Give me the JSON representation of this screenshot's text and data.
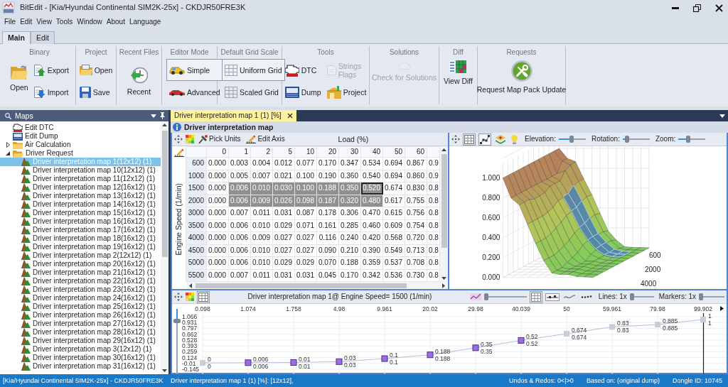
{
  "window": {
    "title": "BitEdit - [Kia/Hyundai Continental SIM2K-25x] - CKDJR50FRE3K"
  },
  "menu": [
    "File",
    "Edit",
    "View",
    "Tools",
    "Window",
    "About",
    "Language"
  ],
  "ribbon_tabs": [
    {
      "label": "Main",
      "selected": true
    },
    {
      "label": "Edit",
      "selected": false
    }
  ],
  "ribbon_groups": [
    {
      "title": "Binary",
      "buttons": [
        {
          "label": "Open",
          "kind": "large"
        },
        {
          "label": "Export",
          "kind": "small"
        },
        {
          "label": "Import",
          "kind": "small"
        }
      ]
    },
    {
      "title": "Project",
      "buttons": [
        {
          "label": "Open",
          "kind": "small"
        },
        {
          "label": "Save",
          "kind": "small"
        }
      ]
    },
    {
      "title": "Recent Files",
      "buttons": [
        {
          "label": "Recent",
          "kind": "large"
        }
      ]
    },
    {
      "title": "Editor Mode",
      "buttons": [
        {
          "label": "Simple",
          "kind": "small",
          "selected": true
        },
        {
          "label": "Advanced",
          "kind": "small",
          "selected": false
        }
      ]
    },
    {
      "title": "Default Grid Scale",
      "buttons": [
        {
          "label": "Uniform Grid",
          "kind": "small",
          "selected": true
        },
        {
          "label": "Scaled Grid",
          "kind": "small",
          "selected": false
        }
      ]
    },
    {
      "title": "Tools",
      "buttons": [
        {
          "label": "DTC",
          "kind": "small",
          "disabled": false
        },
        {
          "label": "Dump",
          "kind": "small",
          "disabled": false
        },
        {
          "label": "Strings Flags",
          "kind": "small",
          "disabled": true
        },
        {
          "label": "Project",
          "kind": "small",
          "disabled": false
        }
      ]
    },
    {
      "title": "Solutions",
      "buttons": [
        {
          "label": "Check for Solutions",
          "kind": "large",
          "disabled": true
        }
      ]
    },
    {
      "title": "Diff",
      "buttons": [
        {
          "label": "View Diff",
          "kind": "large"
        }
      ]
    },
    {
      "title": "Requests",
      "buttons": [
        {
          "label": "Request Map Pack Update",
          "kind": "large"
        }
      ]
    }
  ],
  "maps_panel": {
    "title": "Maps",
    "items": [
      {
        "label": "Edit DTC",
        "kind": "dtc",
        "selected": false
      },
      {
        "label": "Edit Dump",
        "kind": "dump",
        "selected": false
      },
      {
        "label": "Air Calculation",
        "kind": "folder",
        "expanded": false,
        "selected": false
      },
      {
        "label": "Driver Request",
        "kind": "folder",
        "expanded": true,
        "selected": false,
        "children": [
          {
            "label": "Driver interpretation map 1(12x12) (1)",
            "kind": "map",
            "selected": true
          },
          {
            "label": "Driver interpretation map 10(12x12) (1)",
            "kind": "map",
            "selected": false
          },
          {
            "label": "Driver interpretation map 11(12x12) (1)",
            "kind": "map",
            "selected": false
          },
          {
            "label": "Driver interpretation map 12(16x12) (1)",
            "kind": "map",
            "selected": false
          },
          {
            "label": "Driver interpretation map 13(16x12) (1)",
            "kind": "map",
            "selected": false
          },
          {
            "label": "Driver interpretation map 14(16x12) (1)",
            "kind": "map",
            "selected": false
          },
          {
            "label": "Driver interpretation map 15(16x12) (1)",
            "kind": "map",
            "selected": false
          },
          {
            "label": "Driver interpretation map 16(16x12) (1)",
            "kind": "map",
            "selected": false
          },
          {
            "label": "Driver interpretation map 17(16x12) (1)",
            "kind": "map",
            "selected": false
          },
          {
            "label": "Driver interpretation map 18(16x12) (1)",
            "kind": "map",
            "selected": false
          },
          {
            "label": "Driver interpretation map 19(16x12) (1)",
            "kind": "map",
            "selected": false
          },
          {
            "label": "Driver interpretation map 2(12x12) (1)",
            "kind": "map",
            "selected": false
          },
          {
            "label": "Driver interpretation map 20(16x12) (1)",
            "kind": "map",
            "selected": false
          },
          {
            "label": "Driver interpretation map 21(16x12) (1)",
            "kind": "map",
            "selected": false
          },
          {
            "label": "Driver interpretation map 22(16x12) (1)",
            "kind": "map",
            "selected": false
          },
          {
            "label": "Driver interpretation map 23(16x12) (1)",
            "kind": "map",
            "selected": false
          },
          {
            "label": "Driver interpretation map 24(16x12) (1)",
            "kind": "map",
            "selected": false
          },
          {
            "label": "Driver interpretation map 25(16x12) (1)",
            "kind": "map",
            "selected": false
          },
          {
            "label": "Driver interpretation map 26(16x12) (1)",
            "kind": "map",
            "selected": false
          },
          {
            "label": "Driver interpretation map 27(16x12) (1)",
            "kind": "map",
            "selected": false
          },
          {
            "label": "Driver interpretation map 28(16x12) (1)",
            "kind": "map",
            "selected": false
          },
          {
            "label": "Driver interpretation map 29(16x12) (1)",
            "kind": "map",
            "selected": false
          },
          {
            "label": "Driver interpretation map 3(12x12) (1)",
            "kind": "map",
            "selected": false
          },
          {
            "label": "Driver interpretation map 30(16x12) (1)",
            "kind": "map",
            "selected": false
          },
          {
            "label": "Driver interpretation map 31(16x12) (1)",
            "kind": "map",
            "selected": false
          }
        ]
      }
    ]
  },
  "doc_tabs": [
    {
      "label": "Driver interpretation map 1 (1) [%]",
      "selected": true
    }
  ],
  "map_panel": {
    "title": "Driver interpretation map",
    "toolbar_buttons": [
      "Pick Units",
      "Edit Axis"
    ],
    "x_axis_title": "Load (%)",
    "y_axis_title": "Engine Speed (1/min)",
    "columns": [
      "0",
      "1",
      "2",
      "5",
      "10",
      "20",
      "30",
      "40",
      "50",
      "60"
    ],
    "rows": [
      {
        "label": "600",
        "values": [
          "0.000",
          "0.003",
          "0.004",
          "0.012",
          "0.077",
          "0.170",
          "0.347",
          "0.534",
          "0.694",
          "0.867",
          "0.9"
        ],
        "selected": [
          false,
          false,
          false,
          false,
          false,
          false,
          false,
          false,
          false,
          false,
          false
        ],
        "focused": [
          false,
          false,
          false,
          false,
          false,
          false,
          false,
          false,
          false,
          false,
          false
        ]
      },
      {
        "label": "1000",
        "values": [
          "0.000",
          "0.005",
          "0.007",
          "0.021",
          "0.100",
          "0.190",
          "0.360",
          "0.540",
          "0.694",
          "0.860",
          "0.9"
        ],
        "selected": [
          false,
          false,
          false,
          false,
          false,
          false,
          false,
          false,
          false,
          false,
          false
        ],
        "focused": [
          false,
          false,
          false,
          false,
          false,
          false,
          false,
          false,
          false,
          false,
          false
        ]
      },
      {
        "label": "1500",
        "values": [
          "0.000",
          "0.006",
          "0.010",
          "0.030",
          "0.100",
          "0.188",
          "0.350",
          "0.520",
          "0.674",
          "0.830",
          "0.8"
        ],
        "selected": [
          false,
          true,
          true,
          true,
          true,
          true,
          true,
          true,
          false,
          false,
          false
        ],
        "focused": [
          false,
          false,
          false,
          false,
          false,
          false,
          false,
          true,
          false,
          false,
          false
        ]
      },
      {
        "label": "2000",
        "values": [
          "0.000",
          "0.006",
          "0.009",
          "0.026",
          "0.098",
          "0.187",
          "0.320",
          "0.480",
          "0.617",
          "0.755",
          "0.8"
        ],
        "selected": [
          false,
          true,
          true,
          true,
          true,
          true,
          true,
          true,
          false,
          false,
          false
        ],
        "focused": [
          false,
          false,
          false,
          false,
          false,
          false,
          false,
          false,
          false,
          false,
          false
        ]
      },
      {
        "label": "3000",
        "values": [
          "0.000",
          "0.007",
          "0.011",
          "0.031",
          "0.087",
          "0.178",
          "0.306",
          "0.470",
          "0.615",
          "0.756",
          "0.8"
        ],
        "selected": [
          false,
          false,
          false,
          false,
          false,
          false,
          false,
          false,
          false,
          false,
          false
        ],
        "focused": [
          false,
          false,
          false,
          false,
          false,
          false,
          false,
          false,
          false,
          false,
          false
        ]
      },
      {
        "label": "3500",
        "values": [
          "0.000",
          "0.006",
          "0.010",
          "0.029",
          "0.071",
          "0.161",
          "0.285",
          "0.460",
          "0.609",
          "0.754",
          "0.8"
        ],
        "selected": [
          false,
          false,
          false,
          false,
          false,
          false,
          false,
          false,
          false,
          false,
          false
        ],
        "focused": [
          false,
          false,
          false,
          false,
          false,
          false,
          false,
          false,
          false,
          false,
          false
        ]
      },
      {
        "label": "4000",
        "values": [
          "0.000",
          "0.006",
          "0.009",
          "0.027",
          "0.027",
          "0.116",
          "0.240",
          "0.420",
          "0.568",
          "0.720",
          "0.8"
        ],
        "selected": [
          false,
          false,
          false,
          false,
          false,
          false,
          false,
          false,
          false,
          false,
          false
        ],
        "focused": [
          false,
          false,
          false,
          false,
          false,
          false,
          false,
          false,
          false,
          false,
          false
        ]
      },
      {
        "label": "4500",
        "values": [
          "0.000",
          "0.006",
          "0.010",
          "0.027",
          "0.027",
          "0.090",
          "0.210",
          "0.390",
          "0.549",
          "0.713",
          "0.8"
        ],
        "selected": [
          false,
          false,
          false,
          false,
          false,
          false,
          false,
          false,
          false,
          false,
          false
        ],
        "focused": [
          false,
          false,
          false,
          false,
          false,
          false,
          false,
          false,
          false,
          false,
          false
        ]
      },
      {
        "label": "5000",
        "values": [
          "0.000",
          "0.006",
          "0.010",
          "0.029",
          "0.029",
          "0.070",
          "0.188",
          "0.359",
          "0.537",
          "0.708",
          "0.8"
        ],
        "selected": [
          false,
          false,
          false,
          false,
          false,
          false,
          false,
          false,
          false,
          false,
          false
        ],
        "focused": [
          false,
          false,
          false,
          false,
          false,
          false,
          false,
          false,
          false,
          false,
          false
        ]
      },
      {
        "label": "5500",
        "values": [
          "0.000",
          "0.007",
          "0.011",
          "0.031",
          "0.031",
          "0.045",
          "0.170",
          "0.342",
          "0.536",
          "0.730",
          "0.8"
        ],
        "selected": [
          false,
          false,
          false,
          false,
          false,
          false,
          false,
          false,
          false,
          false,
          false
        ],
        "focused": [
          false,
          false,
          false,
          false,
          false,
          false,
          false,
          false,
          false,
          false,
          false
        ]
      }
    ]
  },
  "surface_panel": {
    "toggles": [
      {
        "pressed": true
      },
      {
        "pressed": true
      },
      {
        "pressed": false
      },
      {
        "pressed": false
      }
    ],
    "sliders": [
      {
        "label": "Elevation:",
        "level": 0.47
      },
      {
        "label": "Rotation:",
        "level": 0.15
      },
      {
        "label": "Zoom:",
        "level": 0.37
      }
    ],
    "z_labels": [
      "1.000",
      "0.800",
      "0.600",
      "0.400",
      "0.200",
      "0.000"
    ],
    "y_labels": [
      "600",
      "2000",
      "4000"
    ]
  },
  "profile_chart": {
    "title": "Driver interpretation map 1@ Engine Speed= 1500 (1/min)",
    "toggles": [
      {
        "pressed": true
      },
      {
        "pressed": true
      },
      {
        "pressed": true
      },
      {
        "pressed": false
      },
      {
        "pressed": false
      }
    ],
    "sliders": [
      {
        "level": 0.05
      },
      {
        "label": "Lines: 1x",
        "level": 0.08
      },
      {
        "label": "Markers: 1x",
        "level": 0.08
      }
    ],
    "value_slider": {
      "level": 0.18
    },
    "highlighted": [
      false,
      true,
      true,
      true,
      true,
      true,
      true,
      true,
      false,
      false,
      false,
      false
    ],
    "labels_below": [
      "0",
      "0.006",
      "0.01",
      "0.03",
      "0.1",
      "0.188",
      "0.35",
      "0.52",
      "0.674",
      "0.83",
      "0.885",
      "1"
    ],
    "chart_data": {
      "type": "line",
      "categories": [
        "0.098",
        "1.074",
        "1.758",
        "4.98",
        "9.961",
        "20.02",
        "29.98",
        "40.039",
        "50",
        "59.961",
        "79.98",
        "99.902"
      ],
      "series": [
        {
          "color": "#b4bfdc",
          "marker": "square",
          "values": [
            0,
            0.006,
            0.01,
            0.03,
            0.1,
            0.188,
            0.35,
            0.52,
            0.674,
            0.83,
            0.885,
            1
          ]
        }
      ],
      "ylim": [
        -0.145,
        1.066
      ],
      "yticks": [
        1.066,
        0.931,
        0.797,
        0.662,
        0.528,
        0.393,
        0.259,
        0.124,
        -0.01,
        -0.145
      ],
      "grid": true,
      "data_labels": true,
      "ref_lines": [
        {
          "axis": "x",
          "value": "99.902",
          "color": "#222222"
        }
      ]
    }
  },
  "status_bar": [
    "[Kia/Hyundai Continental SIM2K-25x] - CKDJR50FRE3K",
    "Driver interpretation map 1 (1) [%]: [12x12],",
    "Undos & Redos: 0<|>0",
    "Based on: (original dump)",
    "Dongle ID: 10745"
  ]
}
